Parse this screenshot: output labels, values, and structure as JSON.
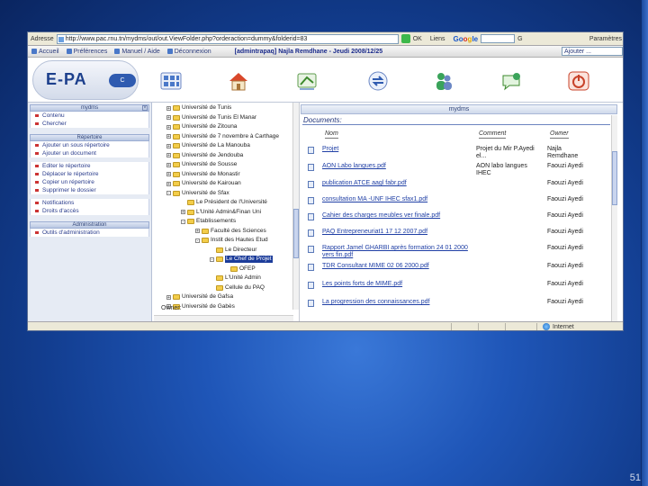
{
  "browser": {
    "address_label": "Adresse",
    "url": "http://www.pac.rnu.tn/mydms/out/out.ViewFolder.php?orderaction=dummy&folderid=83",
    "go_label": "OK",
    "links_label": "Liens",
    "google_label": "Google",
    "settings_label": "Paramètres"
  },
  "navbar": {
    "items": [
      "Accueil",
      "Préférences",
      "Manuel / Aide",
      "Déconnexion"
    ],
    "user_info": "[admintrapaq] Najla Remdhane - Jeudi 2008/12/25",
    "goto_label": "Ajouter ..."
  },
  "header": {
    "logo_main": "E-PA",
    "logo_badge": "C",
    "icons": [
      "grid-icon",
      "home-icon",
      "tools-icon",
      "users-icon",
      "exchange-icon",
      "power-icon"
    ]
  },
  "sidebar": {
    "sections": [
      {
        "title": "mydms",
        "items": [
          "Contenu",
          "Chercher"
        ]
      },
      {
        "title": "Répertoire",
        "items": [
          "Ajouter un sous répertoire",
          "Ajouter un document"
        ]
      },
      {
        "title": "",
        "items": [
          "Editer le répertoire",
          "Déplacer le répertoire",
          "Copier un répertoire",
          "Supprimer le dossier"
        ]
      },
      {
        "title": "",
        "items": [
          "Notifications",
          "Droits d'accès"
        ]
      },
      {
        "title": "Administration",
        "items": [
          "Outils d'administration"
        ]
      }
    ]
  },
  "tree": {
    "nodes": [
      {
        "label": "Université de Tunis",
        "toggle": "+"
      },
      {
        "label": "Université de Tunis El Manar",
        "toggle": "+"
      },
      {
        "label": "Université de Zitouna",
        "toggle": "+"
      },
      {
        "label": "Université de 7 novembre à Carthage",
        "toggle": "+"
      },
      {
        "label": "Université de La Manouba",
        "toggle": "+"
      },
      {
        "label": "Université de Jendouba",
        "toggle": "+"
      },
      {
        "label": "Université de Sousse",
        "toggle": "+"
      },
      {
        "label": "Université de Monastir",
        "toggle": "+"
      },
      {
        "label": "Université de Kairouan",
        "toggle": "+"
      },
      {
        "label": "Université de Sfax",
        "toggle": "-"
      },
      {
        "label": "Le Président de l'Université",
        "toggle": ""
      },
      {
        "label": "L'Unité Admin&Finan Uni",
        "toggle": "+"
      },
      {
        "label": "Etablissements",
        "toggle": "-"
      },
      {
        "label": "Faculté des Sciences",
        "toggle": "+"
      },
      {
        "label": "Instit des Hautes Etud",
        "toggle": "-"
      },
      {
        "label": "Le Directeur",
        "toggle": ""
      },
      {
        "label": "Le Chef de Projet",
        "toggle": "-"
      },
      {
        "label": "OFEP",
        "toggle": ""
      },
      {
        "label": "L'Unité Admin",
        "toggle": ""
      },
      {
        "label": "Cellule du PAQ",
        "toggle": ""
      },
      {
        "label": "Université de Gafsa",
        "toggle": "+"
      },
      {
        "label": "Université de Gabès",
        "toggle": "+"
      }
    ],
    "owner_label": "Owner:"
  },
  "documents": {
    "bar_title": "mydms",
    "title": "Documents:",
    "columns": [
      "Nom",
      "Comment",
      "Owner"
    ],
    "rows": [
      {
        "name": "Projet",
        "comment": "Projet du Mir P.Ayedi el...",
        "owner": "Najla Remdhane"
      },
      {
        "name": "AON Labo langues.pdf",
        "comment": "AON labo langues IHEC",
        "owner": "Faouzi Ayedi"
      },
      {
        "name": "publication ATCE aagl fabr.pdf",
        "comment": "",
        "owner": "Faouzi Ayedi"
      },
      {
        "name": "consultation MA -UNF IHEC sfax1.pdf",
        "comment": "",
        "owner": "Faouzi Ayedi"
      },
      {
        "name": "Cahier des charges meubles ver finale.pdf",
        "comment": "",
        "owner": "Faouzi Ayedi"
      },
      {
        "name": "PAQ Entrepreneuriat1 17 12 2007.pdf",
        "comment": "",
        "owner": "Faouzi Ayedi"
      },
      {
        "name": "Rapport Jamel GHARBI après formation 24 01 2000 vers fin.pdf",
        "comment": "",
        "owner": "Faouzi Ayedi"
      },
      {
        "name": "TDR Consultant MIME 02 06 2000.pdf",
        "comment": "",
        "owner": "Faouzi Ayedi"
      },
      {
        "name": "Les points forts de MIME.pdf",
        "comment": "",
        "owner": "Faouzi Ayedi"
      },
      {
        "name": "La progression des connaissances.pdf",
        "comment": "",
        "owner": "Faouzi Ayedi"
      }
    ]
  },
  "status": {
    "zone": "Internet"
  },
  "slide": {
    "number": "51"
  }
}
